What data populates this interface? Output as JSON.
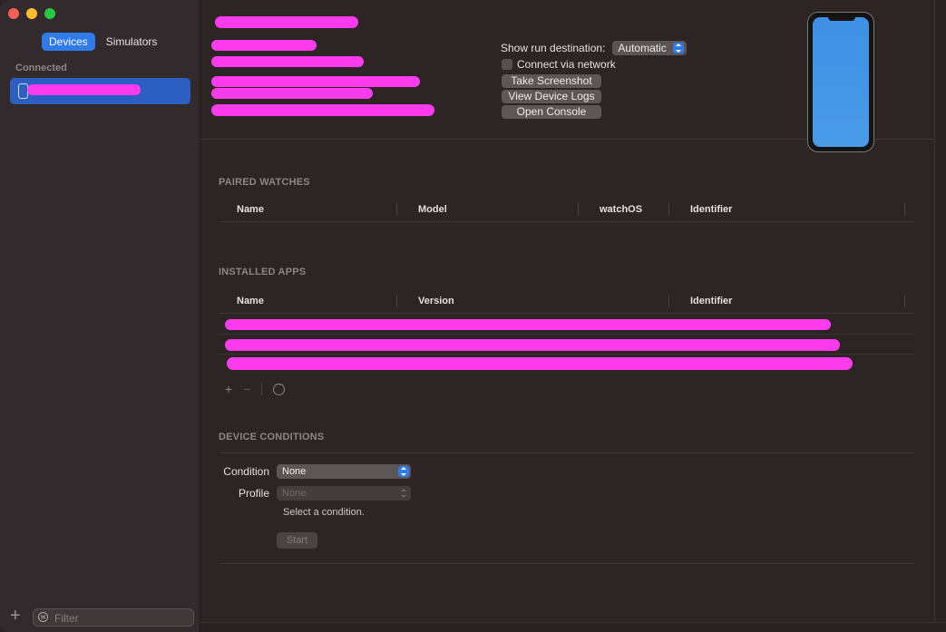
{
  "sidebar": {
    "tabs": [
      {
        "label": "Devices",
        "active": true
      },
      {
        "label": "Simulators",
        "active": false
      }
    ],
    "section_label": "Connected",
    "filter_placeholder": "Filter"
  },
  "header": {
    "run_destination_label": "Show run destination:",
    "run_destination_value": "Automatic",
    "connect_network_label": "Connect via network",
    "buttons": {
      "take_screenshot": "Take Screenshot",
      "view_device_logs": "View Device Logs",
      "open_console": "Open Console"
    }
  },
  "paired_watches": {
    "title": "PAIRED WATCHES",
    "columns": [
      "Name",
      "Model",
      "watchOS",
      "Identifier"
    ]
  },
  "installed_apps": {
    "title": "INSTALLED APPS",
    "columns": [
      "Name",
      "Version",
      "Identifier"
    ]
  },
  "device_conditions": {
    "title": "DEVICE CONDITIONS",
    "condition_label": "Condition",
    "condition_value": "None",
    "profile_label": "Profile",
    "profile_value": "None",
    "hint": "Select a condition.",
    "start_label": "Start"
  },
  "colors": {
    "accent": "#2f7bea",
    "redaction": "#ff3bee",
    "background": "#2d2424"
  }
}
